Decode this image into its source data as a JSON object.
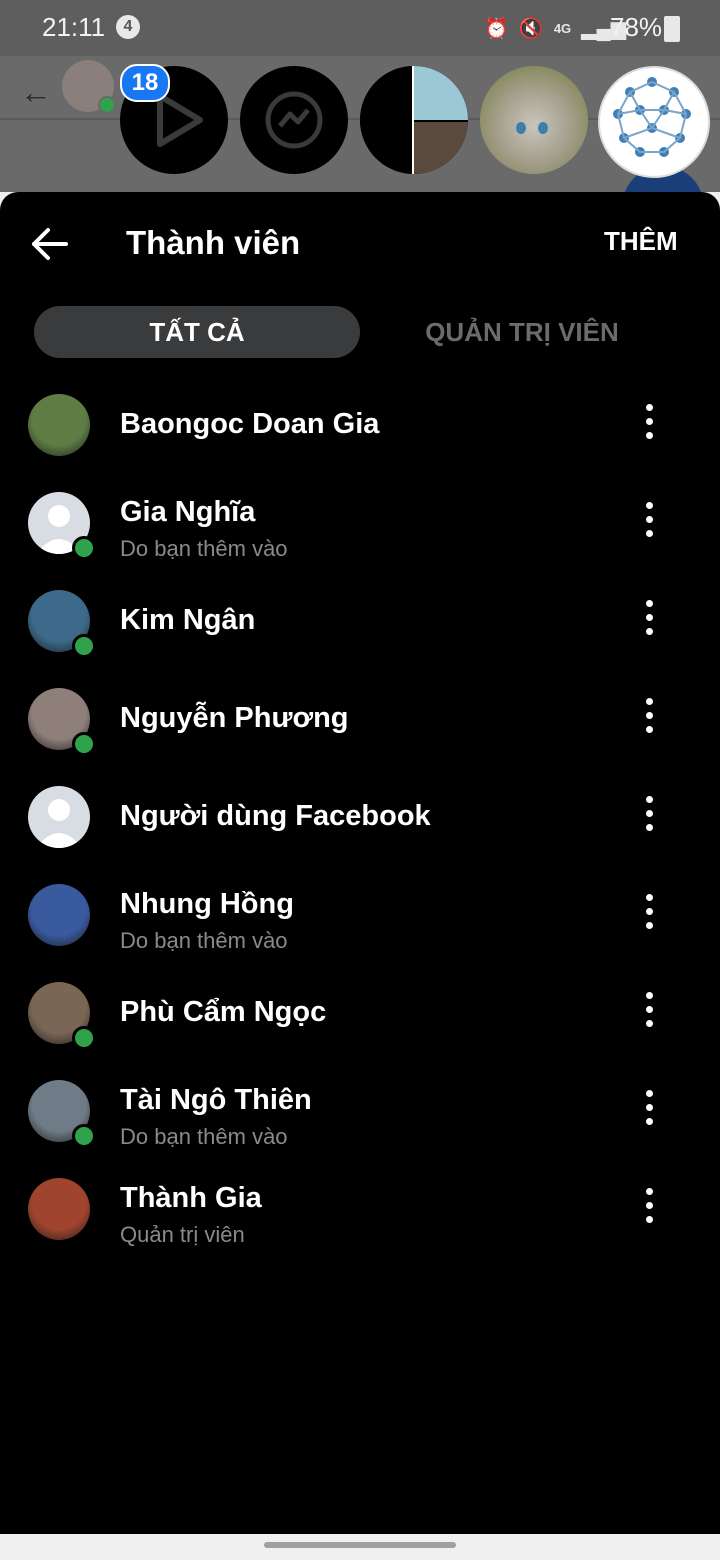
{
  "status_bar": {
    "time": "21:11",
    "notification_count": "4",
    "battery": "78%",
    "network_label": "4G"
  },
  "chat_heads": {
    "unread_badge": "18",
    "items": [
      "play-icon",
      "messenger-icon",
      "group-photo",
      "cat-photo",
      "molecule-photo"
    ]
  },
  "header": {
    "title": "Thành viên",
    "add_label": "THÊM"
  },
  "tabs": {
    "all": "TẤT CẢ",
    "admins": "QUẢN TRỊ VIÊN",
    "active": "all"
  },
  "members": [
    {
      "name": "Baongoc Doan Gia",
      "subtitle": "",
      "online": false,
      "avatar_color": "#5e7d45"
    },
    {
      "name": "Gia Nghĩa",
      "subtitle": "Do bạn thêm vào",
      "online": true,
      "avatar_color": "#d8dce3"
    },
    {
      "name": "Kim Ngân",
      "subtitle": "",
      "online": true,
      "avatar_color": "#3d6a8a"
    },
    {
      "name": "Nguyễn Phương",
      "subtitle": "",
      "online": true,
      "avatar_color": "#8f7f7a"
    },
    {
      "name": "Người dùng Facebook",
      "subtitle": "",
      "online": false,
      "avatar_color": "#d8dce3"
    },
    {
      "name": "Nhung Hồng",
      "subtitle": "Do bạn thêm vào",
      "online": false,
      "avatar_color": "#3a5aa0"
    },
    {
      "name": "Phù Cẩm Ngọc",
      "subtitle": "",
      "online": true,
      "avatar_color": "#7a6654"
    },
    {
      "name": "Tài Ngô Thiên",
      "subtitle": "Do bạn thêm vào",
      "online": true,
      "avatar_color": "#6f7b86"
    },
    {
      "name": "Thành Gia",
      "subtitle": "Quản trị viên",
      "online": false,
      "avatar_color": "#a0442e"
    }
  ],
  "colors": {
    "online": "#31a24c",
    "badge": "#1877f2",
    "sheet_background": "#000000"
  }
}
